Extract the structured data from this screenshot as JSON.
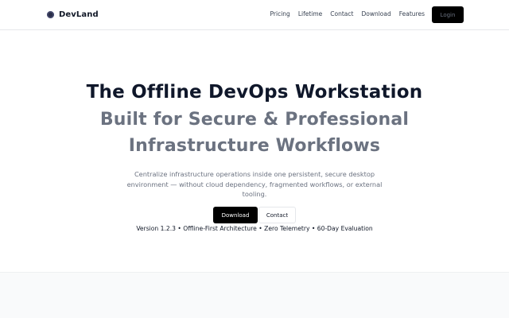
{
  "navbar": {
    "brand_name": "DevLand",
    "links": [
      "Pricing",
      "Lifetime",
      "Contact",
      "Download",
      "Features"
    ],
    "login_label": "Login"
  },
  "hero": {
    "title": "The Offline DevOps Workstation",
    "subtitle_lines": [
      "Built for Secure & Professional",
      "Infrastructure Workflows"
    ],
    "description": "Centralize infrastructure operations inside one persistent, secure desktop environment — without cloud dependency, fragmented workflows, or external tooling.",
    "primary_button": "Download",
    "secondary_button": "Contact",
    "meta": "Version 1.2.3 • Offline-First Architecture • Zero Telemetry • 60-Day Evaluation"
  },
  "colors": {
    "title": "#0f172a",
    "subtitle": "#6b7280",
    "button_dark": "#000000",
    "band_bg": "#f9fafb"
  },
  "icons": {
    "brand": "logo-dot-icon"
  }
}
